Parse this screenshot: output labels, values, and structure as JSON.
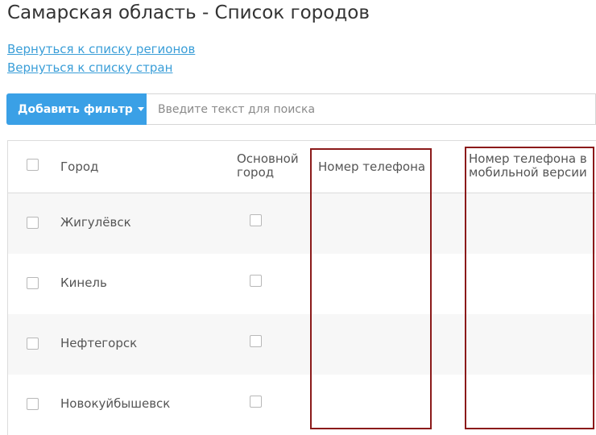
{
  "page": {
    "title": "Самарская область - Список городов"
  },
  "links": {
    "back_regions": "Вернуться к списку регионов",
    "back_countries": "Вернуться к списку стран"
  },
  "toolbar": {
    "add_filter_label": "Добавить фильтр",
    "search_placeholder": "Введите текст для поиска"
  },
  "table": {
    "columns": {
      "city": "Город",
      "main_city_line1": "Основной",
      "main_city_line2": "город",
      "phone": "Номер телефона",
      "mobile_phone_line1": "Номер телефона в",
      "mobile_phone_line2": "мобильной версии"
    },
    "rows": [
      {
        "city": "Жигулёвск",
        "main": false,
        "phone": "",
        "mobile_phone": ""
      },
      {
        "city": "Кинель",
        "main": false,
        "phone": "",
        "mobile_phone": ""
      },
      {
        "city": "Нефтегорск",
        "main": false,
        "phone": "",
        "mobile_phone": ""
      },
      {
        "city": "Новокуйбышевск",
        "main": false,
        "phone": "",
        "mobile_phone": ""
      }
    ]
  },
  "colors": {
    "accent": "#3aa0e6",
    "link": "#3a9ed8",
    "highlight": "#8b1a1a",
    "row_alt": "#f7f7f7"
  }
}
